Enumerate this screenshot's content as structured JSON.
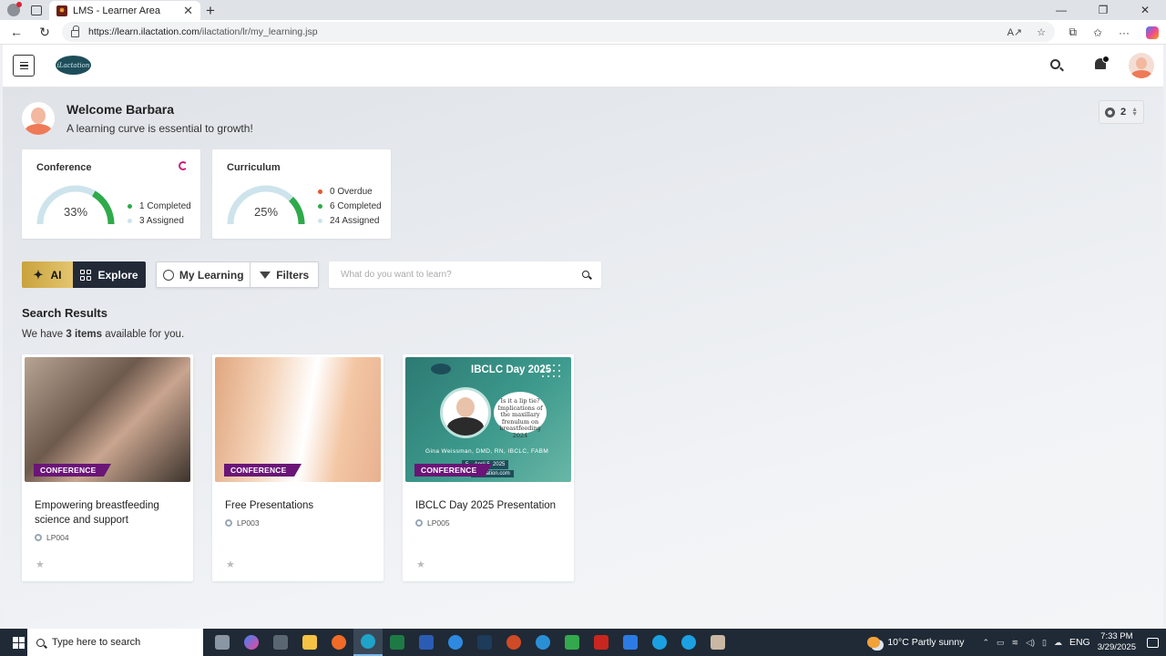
{
  "browser": {
    "tab_title": "LMS - Learner Area",
    "url_host": "https://learn.ilactation.com",
    "url_path": "/ilactation/lr/my_learning.jsp"
  },
  "header": {
    "logo_text": "iLactation"
  },
  "welcome": {
    "title": "Welcome Barbara",
    "subtitle": "A learning curve is essential to growth!",
    "settings_count": "2"
  },
  "conference_card": {
    "title": "Conference",
    "percent_label": "33%",
    "progress_fraction": 0.33,
    "legend": [
      {
        "label": "1 Completed",
        "color": "#2eaa4a"
      },
      {
        "label": "3 Assigned",
        "color": "#cde4ec"
      }
    ]
  },
  "curriculum_card": {
    "title": "Curriculum",
    "percent_label": "25%",
    "progress_fraction": 0.25,
    "legend": [
      {
        "label": "0 Overdue",
        "color": "#e8542c"
      },
      {
        "label": "6 Completed",
        "color": "#2eaa4a"
      },
      {
        "label": "24 Assigned",
        "color": "#cde4ec"
      }
    ]
  },
  "toolbar": {
    "ai_label": "AI",
    "explore_label": "Explore",
    "my_learning_label": "My Learning",
    "filters_label": "Filters",
    "search_placeholder": "What do you want to learn?"
  },
  "results": {
    "title": "Search Results",
    "prefix": "We have ",
    "count_text": "3 items",
    "suffix": " available for you."
  },
  "courses": [
    {
      "badge": "CONFERENCE",
      "title": "Empowering breastfeeding science and support",
      "code": "LP004"
    },
    {
      "badge": "CONFERENCE",
      "title": "Free Presentations",
      "code": "LP003"
    },
    {
      "badge": "CONFERENCE",
      "title": "IBCLC Day 2025 Presentation",
      "code": "LP005"
    }
  ],
  "ibclc_thumb": {
    "title": "IBCLC Day 2025",
    "bubble_text": "Is it a lip tie? Implications of the maxillary frenulum on breastfeeding 2024",
    "name": "Gina Weissman, DMD, RN, IBCLC, FABM",
    "date": "5 – April 5, 2025",
    "site": "iLactation.com"
  },
  "taskbar": {
    "search_placeholder": "Type here to search",
    "weather": "10°C  Partly sunny",
    "language": "ENG",
    "time": "7:33 PM",
    "date": "3/29/2025"
  },
  "colors": {
    "accent_gold": "#d4b04f",
    "explore_dark": "#222a38",
    "badge_purple": "#6a1577",
    "complete_green": "#2eaa4a",
    "overdue_orange": "#e8542c"
  }
}
